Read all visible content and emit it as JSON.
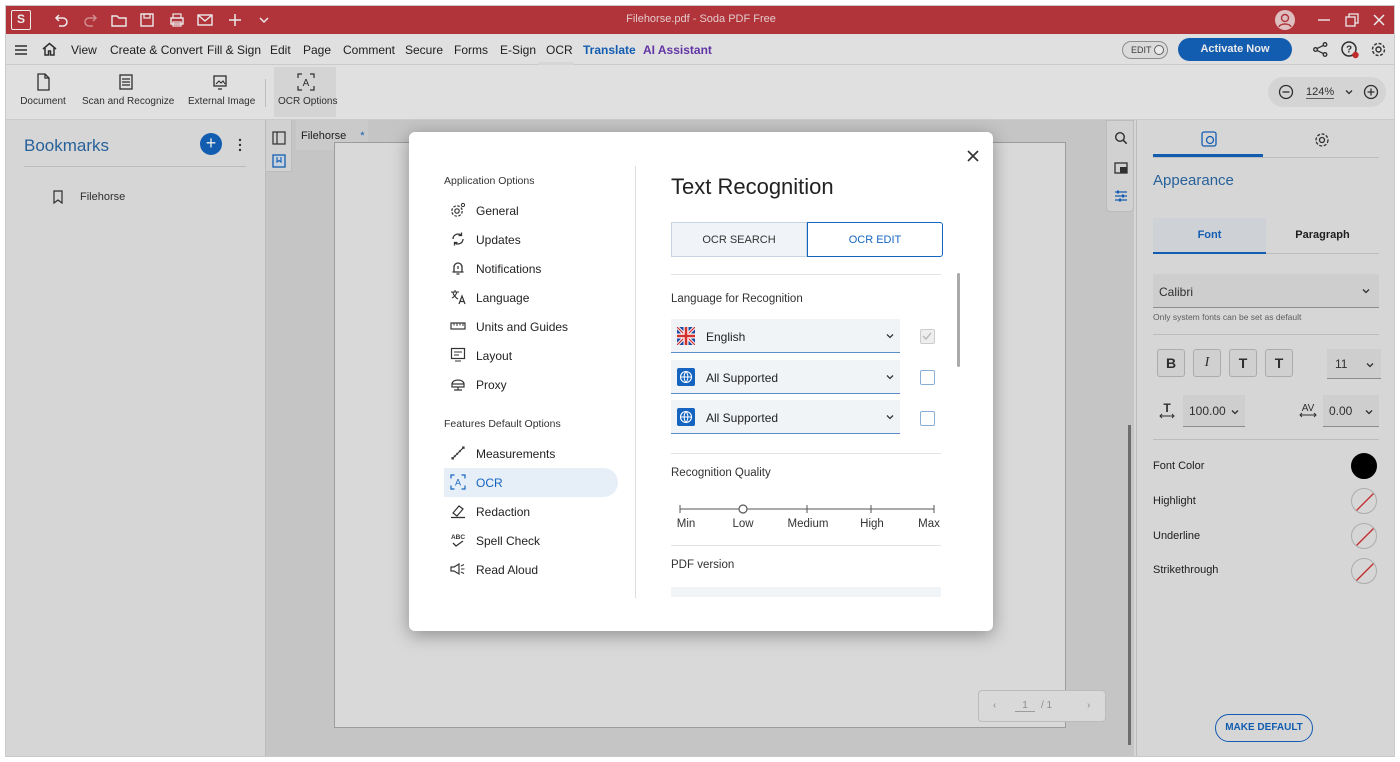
{
  "window": {
    "title": "Filehorse.pdf  -  Soda PDF Free",
    "logo_letter": "S"
  },
  "menu": {
    "items": [
      "View",
      "Create & Convert",
      "Fill & Sign",
      "Edit",
      "Page",
      "Comment",
      "Secure",
      "Forms",
      "E-Sign",
      "OCR",
      "Translate",
      "AI Assistant"
    ],
    "active": "OCR",
    "edit_toggle": "EDIT",
    "activate": "Activate Now"
  },
  "ribbon": {
    "document": "Document",
    "scan": "Scan and Recognize",
    "external_image": "External Image",
    "ocr_options": "OCR Options",
    "zoom": "124%"
  },
  "left_panel": {
    "title": "Bookmarks",
    "bookmarks": [
      "Filehorse"
    ]
  },
  "doc": {
    "tab_name": "Filehorse",
    "tab_modified": "*",
    "page_current": "1",
    "page_total": "/ 1"
  },
  "right_panel": {
    "section": "Appearance",
    "tabs": [
      "Font",
      "Paragraph"
    ],
    "font": "Calibri",
    "font_hint": "Only system fonts can be set as default",
    "format_buttons": [
      "B",
      "I",
      "T",
      "T"
    ],
    "font_size": "11",
    "scale": "100.00",
    "spacing": "0.00",
    "props": [
      "Font Color",
      "Highlight",
      "Underline",
      "Strikethrough"
    ],
    "make_default": "MAKE DEFAULT"
  },
  "dialog": {
    "app_section": "Application Options",
    "app_items": [
      "General",
      "Updates",
      "Notifications",
      "Language",
      "Units and Guides",
      "Layout",
      "Proxy"
    ],
    "features_section": "Features Default Options",
    "feature_items": [
      "Measurements",
      "OCR",
      "Redaction",
      "Spell Check",
      "Read Aloud"
    ],
    "selected": "OCR",
    "title": "Text Recognition",
    "seg_search": "OCR SEARCH",
    "seg_edit": "OCR EDIT",
    "lang_label": "Language for Recognition",
    "languages": [
      "English",
      "All Supported",
      "All Supported"
    ],
    "quality_label": "Recognition Quality",
    "quality_levels": [
      "Min",
      "Low",
      "Medium",
      "High",
      "Max"
    ],
    "quality_value": "Low",
    "pdf_label": "PDF version"
  }
}
